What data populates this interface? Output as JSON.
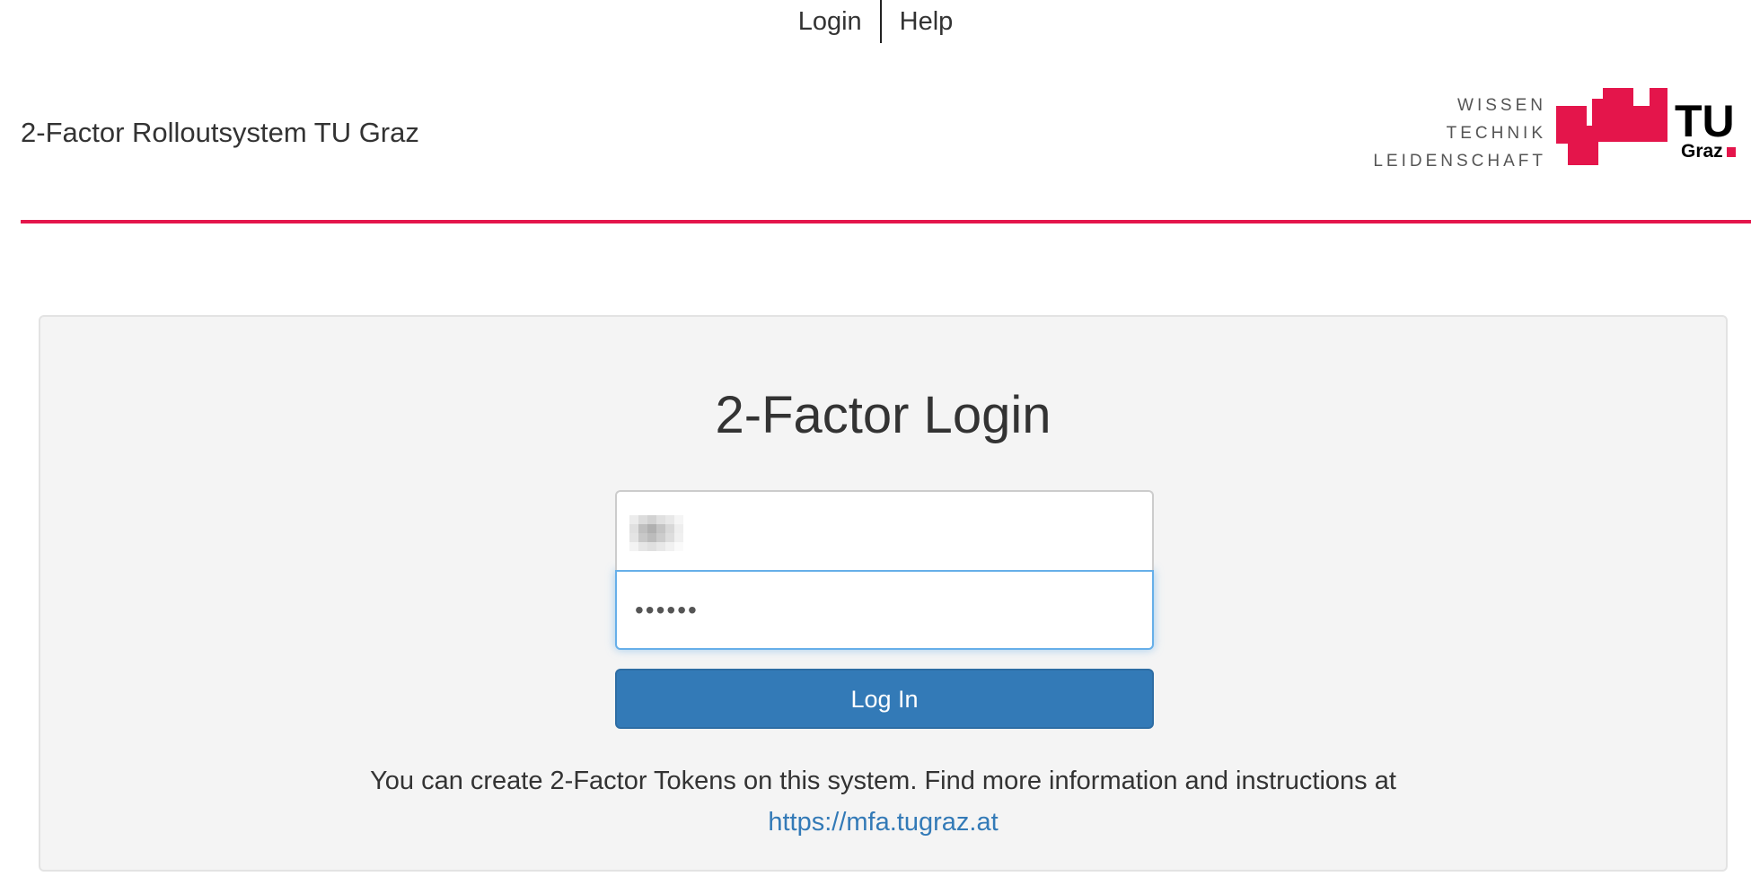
{
  "nav": {
    "login_label": "Login",
    "help_label": "Help"
  },
  "header": {
    "site_title": "2-Factor Rolloutsystem TU Graz",
    "tagline": [
      "WISSEN",
      "TECHNIK",
      "LEIDENSCHAFT"
    ],
    "logo_text_main": "TU",
    "logo_text_sub": "Graz",
    "accent_color": "#e4154b"
  },
  "login": {
    "title": "2-Factor Login",
    "username_value": "",
    "password_value": "••••••",
    "button_label": "Log In",
    "button_color": "#337ab7",
    "info_text": "You can create 2-Factor Tokens on this system. Find more information and instructions at",
    "info_link": "https://mfa.tugraz.at"
  }
}
